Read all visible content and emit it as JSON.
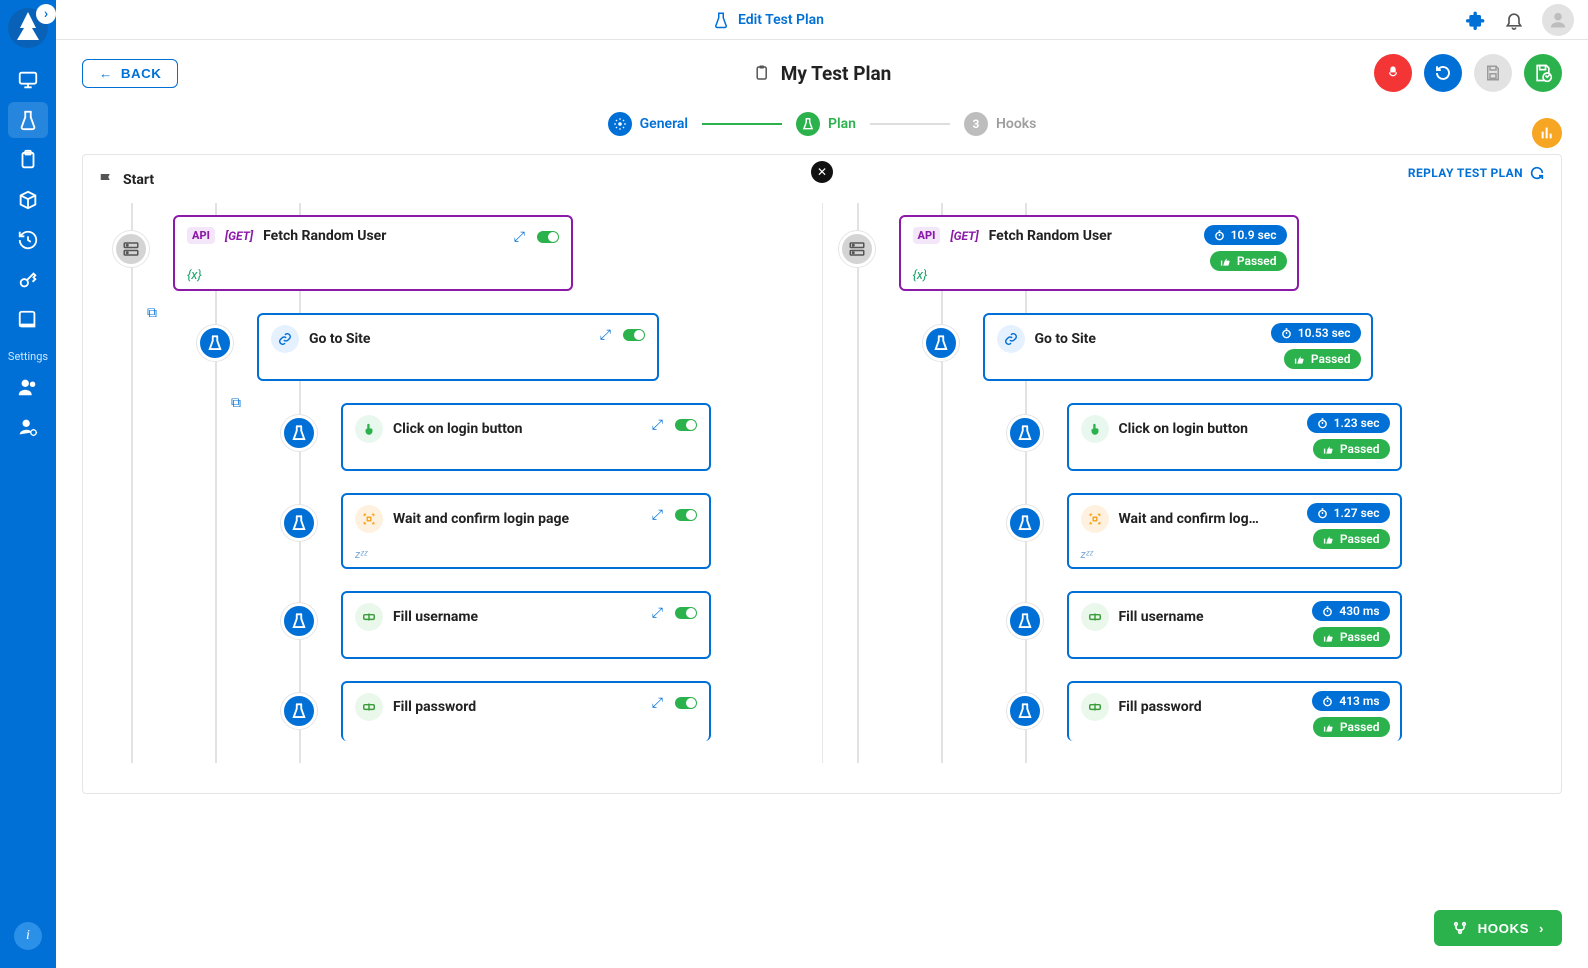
{
  "header": {
    "title": "Edit Test Plan"
  },
  "rail": {
    "settings_label": "Settings"
  },
  "page": {
    "back_label": "BACK",
    "title": "My Test Plan",
    "stepper": {
      "general": "General",
      "plan": "Plan",
      "hooks_num": "3",
      "hooks": "Hooks"
    },
    "replay": "REPLAY TEST PLAN",
    "start": "Start",
    "hooks_btn": "HOOKS"
  },
  "left_steps": {
    "api": {
      "label": "Fetch Random User",
      "method": "[GET]",
      "tag": "API",
      "var": "{x}"
    },
    "s1": {
      "label": "Go to Site"
    },
    "s2": {
      "label": "Click on login button"
    },
    "s3": {
      "label": "Wait and confirm login page",
      "zzz": "zᶻᶻ"
    },
    "s4": {
      "label": "Fill username"
    },
    "s5": {
      "label": "Fill password"
    }
  },
  "right_steps": {
    "api": {
      "label": "Fetch Random User",
      "method": "[GET]",
      "tag": "API",
      "var": "{x}",
      "time": "10.9 sec",
      "status": "Passed"
    },
    "s1": {
      "label": "Go to Site",
      "time": "10.53 sec",
      "status": "Passed"
    },
    "s2": {
      "label": "Click on login button",
      "time": "1.23 sec",
      "status": "Passed"
    },
    "s3": {
      "label": "Wait and confirm log…",
      "zzz": "zᶻᶻ",
      "time": "1.27 sec",
      "status": "Passed"
    },
    "s4": {
      "label": "Fill username",
      "time": "430 ms",
      "status": "Passed"
    },
    "s5": {
      "label": "Fill password",
      "time": "413 ms",
      "status": "Passed"
    }
  }
}
